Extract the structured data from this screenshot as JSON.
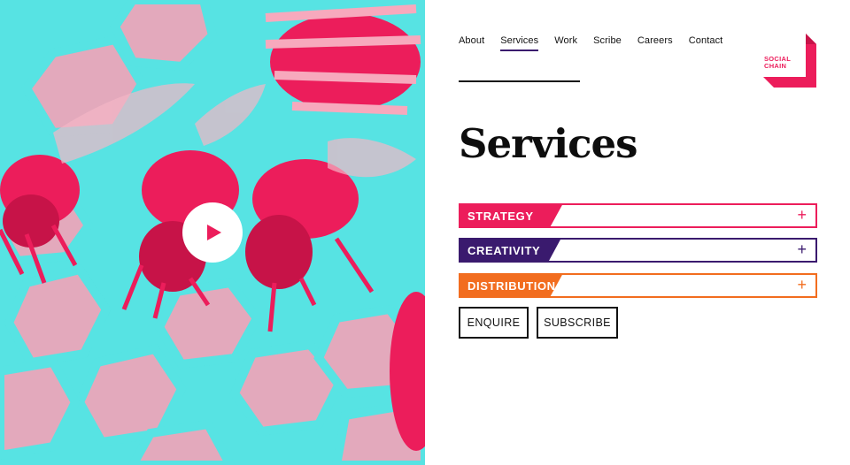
{
  "hero": {
    "play_label": "Play video"
  },
  "nav": {
    "items": [
      {
        "label": "About"
      },
      {
        "label": "Services",
        "active": true
      },
      {
        "label": "Work"
      },
      {
        "label": "Scribe"
      },
      {
        "label": "Careers"
      },
      {
        "label": "Contact"
      }
    ]
  },
  "logo": {
    "line1": "SOCIAL",
    "line2": "CHAIN",
    "color": "#ec1d5b"
  },
  "page_title": "Services",
  "accordion": [
    {
      "label": "STRATEGY",
      "color": "#ec1d5b",
      "icon": "plus-icon"
    },
    {
      "label": "CREATIVITY",
      "color": "#3a1a6e",
      "icon": "plus-icon"
    },
    {
      "label": "DISTRIBUTION",
      "color": "#f26d1f",
      "icon": "plus-icon"
    }
  ],
  "buttons": {
    "enquire": "ENQUIRE",
    "subscribe": "SUBSCRIBE"
  },
  "colors": {
    "hero_cyan": "#57e3e3",
    "hero_pink": "#ec1d5b"
  }
}
